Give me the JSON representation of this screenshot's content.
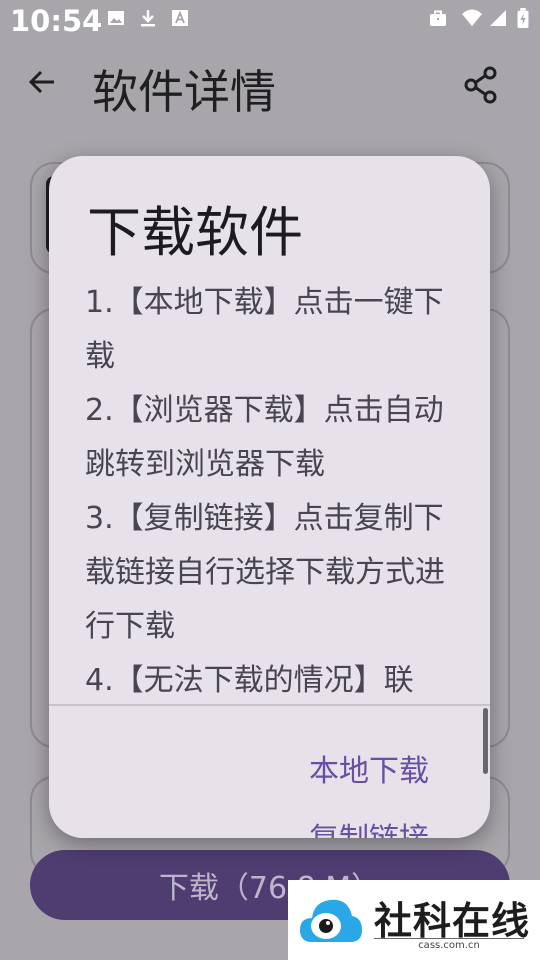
{
  "status_bar": {
    "time": "10:54",
    "icons_left": [
      "image-icon",
      "download-icon",
      "text-a-icon"
    ],
    "icons_right": [
      "briefcase-icon",
      "wifi-icon",
      "signal-icon",
      "battery-icon"
    ]
  },
  "app_bar": {
    "title": "软件详情",
    "back_icon": "arrow-left-icon",
    "share_icon": "share-icon"
  },
  "download_button": {
    "label": "下载（76.8 M）"
  },
  "dialog": {
    "title": "下载软件",
    "body_lines": [
      " 1.【本地下载】点击一键下载",
      "2.【浏览器下载】点击自动跳转到浏览器下载",
      "3.【复制链接】点击复制下载链接自行选择下载方式进行下载",
      "4.【无法下载的情况】联"
    ],
    "actions": {
      "local_download": "本地下载",
      "copy_link": "复制链接"
    }
  },
  "watermark": {
    "name": "社科在线",
    "url": "cass.com.cn"
  },
  "colors": {
    "scrim_background": "#a9a6ab",
    "dialog_surface": "#e7e1ea",
    "accent": "#6750a4",
    "download_bar": "#4f3d72"
  }
}
